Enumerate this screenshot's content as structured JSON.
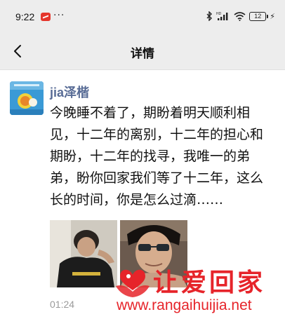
{
  "status_bar": {
    "time": "9:22",
    "more": "···",
    "battery_level": "12",
    "icons": [
      "notification-app-icon",
      "bluetooth-icon",
      "hd-signal-icon",
      "wifi-icon",
      "battery-icon",
      "charging-icon"
    ]
  },
  "nav": {
    "title": "详情",
    "back_icon": "chevron-left-icon"
  },
  "post": {
    "author": "jia泽楷",
    "text": "今晚睡不着了，期盼着明天顺利相见，十二年的离别，十二年的担心和期盼，十二年的找寻，我唯一的弟弟，盼你回家我们等了十二年，这么长的时间，你是怎么过滴……",
    "photo_count": 2,
    "time": "01:24"
  },
  "watermark": {
    "chinese": "让爱回家",
    "url": "www.rangaihuijia.net",
    "color": "#e6242a"
  },
  "colors": {
    "author": "#576b95",
    "chrome": "#ededed"
  }
}
